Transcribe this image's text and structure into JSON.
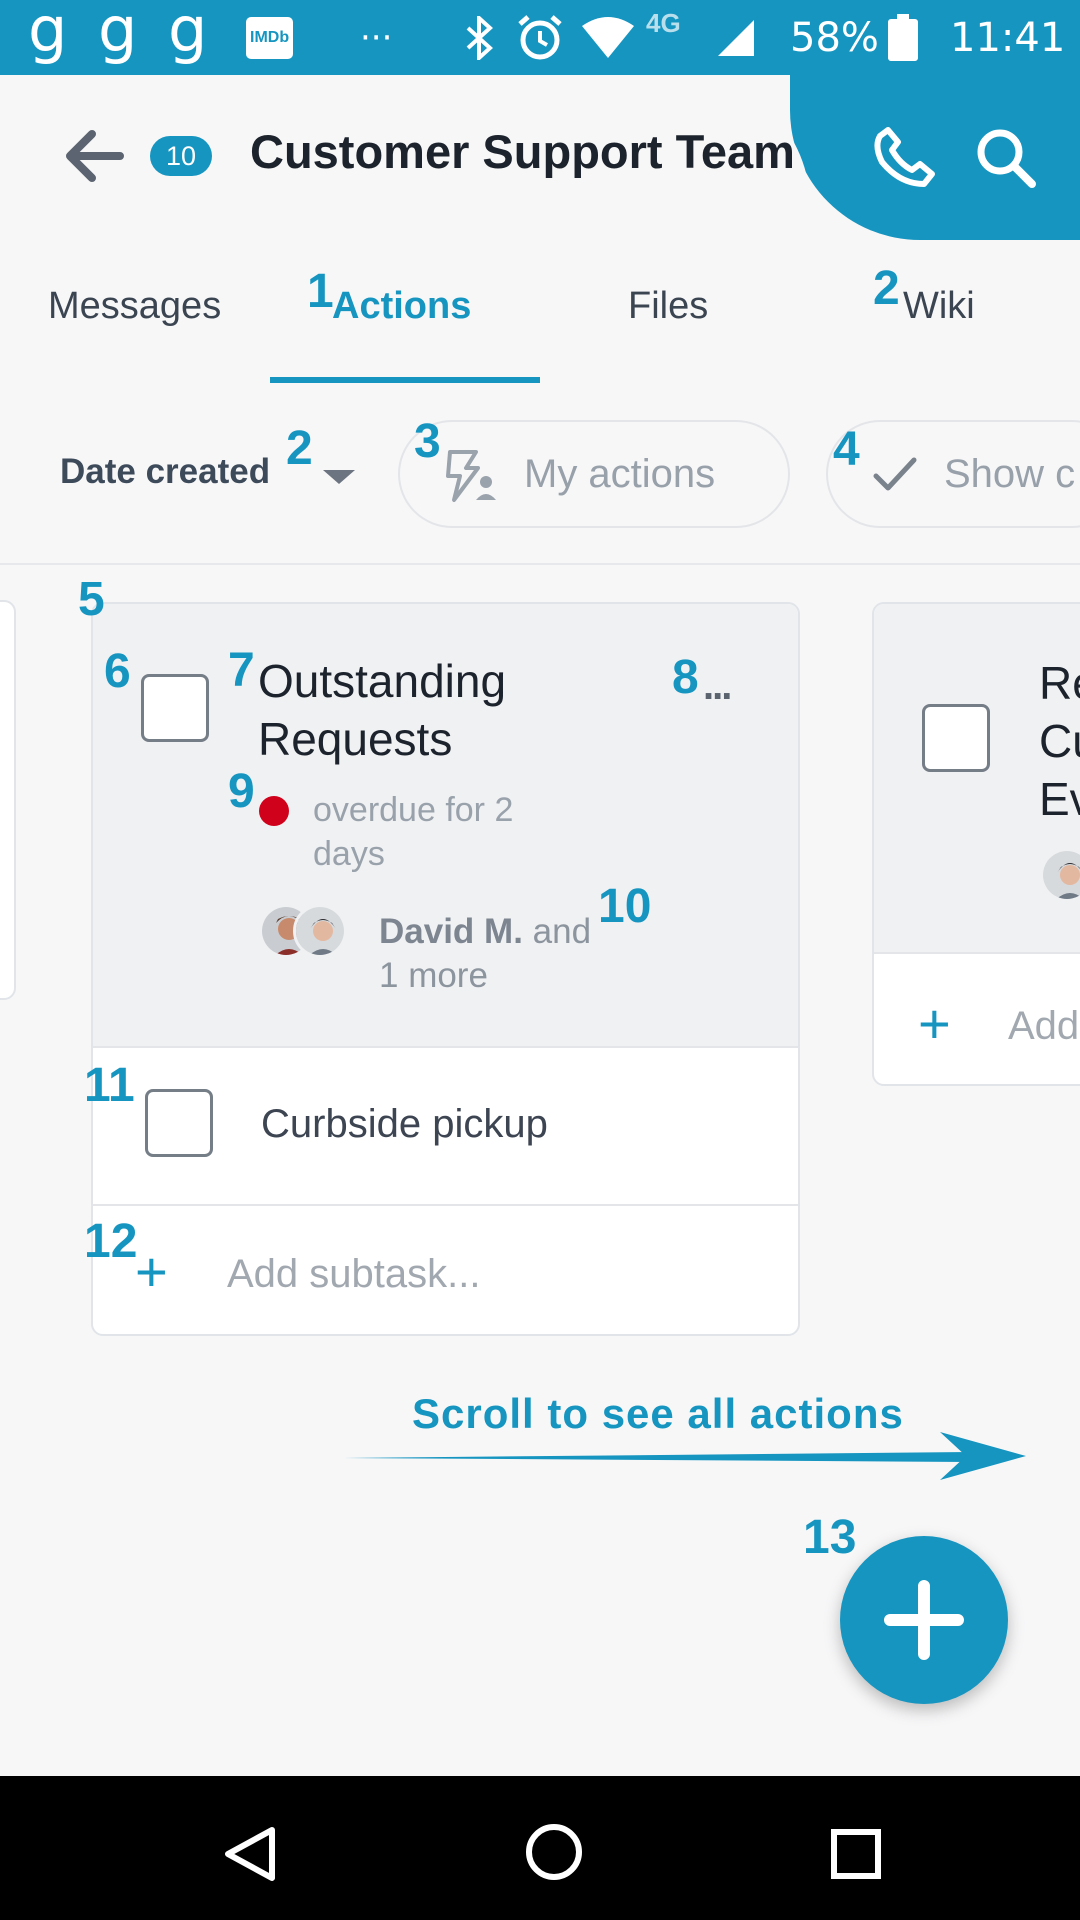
{
  "status_bar": {
    "left_icons": [
      "g-icon",
      "g-icon",
      "g-icon",
      "imdb-icon",
      "more-dots-icon"
    ],
    "imdb_label": "IMDb",
    "more": "···",
    "network": "4G",
    "battery": "58%",
    "time": "11:41"
  },
  "header": {
    "unread_count": "10",
    "title": "Customer Support Team",
    "icons": [
      "back-arrow-icon",
      "phone-icon",
      "search-icon"
    ]
  },
  "tabs": [
    {
      "label": "Messages",
      "active": false
    },
    {
      "label": "Actions",
      "active": true
    },
    {
      "label": "Files",
      "active": false
    },
    {
      "label": "Wiki",
      "active": false
    }
  ],
  "filters": {
    "sort_label": "Date created",
    "my_actions_label": "My actions",
    "show_completed_label": "Show c"
  },
  "annotations": [
    "1",
    "2",
    "2",
    "3",
    "4",
    "5",
    "6",
    "7",
    "8",
    "9",
    "10",
    "11",
    "12",
    "13"
  ],
  "card_main": {
    "title": "Outstanding Requests",
    "more": "...",
    "overdue_line1": "overdue for 2",
    "overdue_line2": "days",
    "assignee_name": "David M.",
    "assignee_rest": " and",
    "assignee_line2": "1 more",
    "subtask": "Curbside pickup",
    "add_subtask": "Add subtask..."
  },
  "card_next": {
    "title_lines": [
      "Re",
      "Cu",
      "Ev"
    ],
    "add_label": "Add"
  },
  "scroll_hint": "Scroll to see all actions",
  "colors": {
    "accent": "#1595c0",
    "overdue": "#d0021b",
    "title_text": "#1c232c"
  }
}
